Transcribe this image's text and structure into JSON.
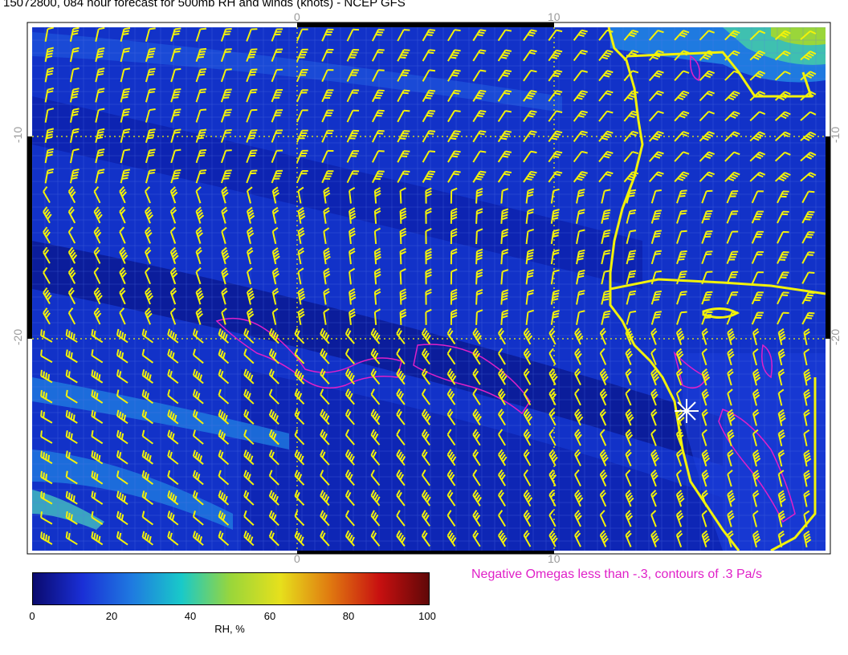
{
  "title": "15072800, 084 hour forecast for 500mb RH and winds (knots) - NCEP GFS",
  "axes": {
    "x_top": [
      "0",
      "10"
    ],
    "x_bottom": [
      "0",
      "10"
    ],
    "y_left": [
      "-10",
      "-20"
    ],
    "y_right": [
      "-10",
      "-20"
    ]
  },
  "colorbar": {
    "labels": [
      "0",
      "20",
      "40",
      "60",
      "80",
      "100"
    ],
    "title": "RH, %",
    "stops": [
      "#0a0a6e",
      "#1a2fd6",
      "#1f7ae0",
      "#19c9c9",
      "#9ad63a",
      "#e6e01c",
      "#e07a10",
      "#c81010",
      "#600808"
    ]
  },
  "legend_note": "Negative Omegas less than -.3, contours of .3 Pa/s",
  "colors": {
    "wind_barbs": "#f2f20a",
    "coastline": "#f2f20a",
    "omega_contours": "#e020c8",
    "background_rh": "#1232c8"
  }
}
